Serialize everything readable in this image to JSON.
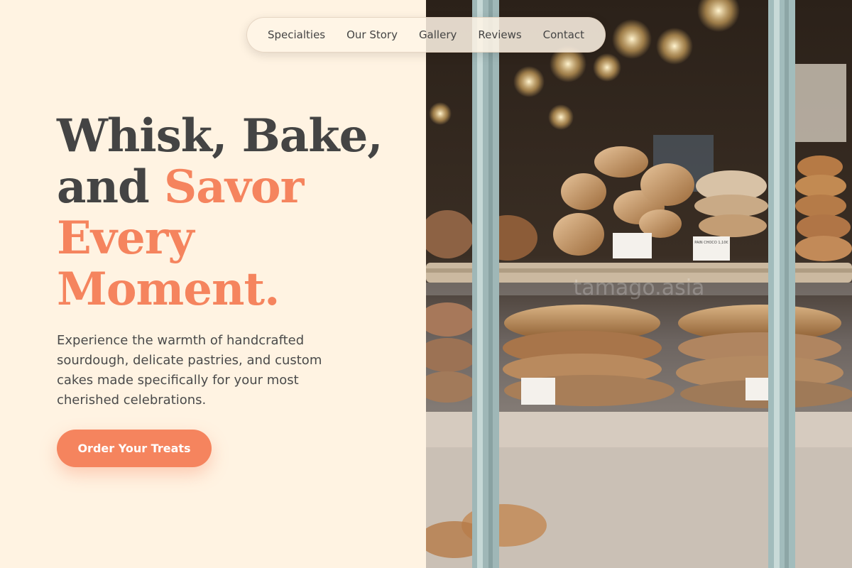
{
  "nav": {
    "items": [
      "Specialties",
      "Our Story",
      "Gallery",
      "Reviews",
      "Contact"
    ]
  },
  "hero": {
    "headline_line1": "Whisk, Bake,",
    "headline_line2_plain": "and ",
    "headline_line2_accent": "Savor",
    "headline_line3": "Every",
    "headline_line4": "Moment.",
    "description": "Experience the warmth of handcrafted sourdough, delicate pastries, and custom cakes made specifically for your most cherished celebrations.",
    "cta_label": "Order Your Treats"
  },
  "photo": {
    "price_tag_left": "PAIN CHOCO 1,10€",
    "watermark": "tamago.asia"
  },
  "colors": {
    "background": "#fff3e2",
    "accent": "#f5845e",
    "heading": "#444444"
  }
}
